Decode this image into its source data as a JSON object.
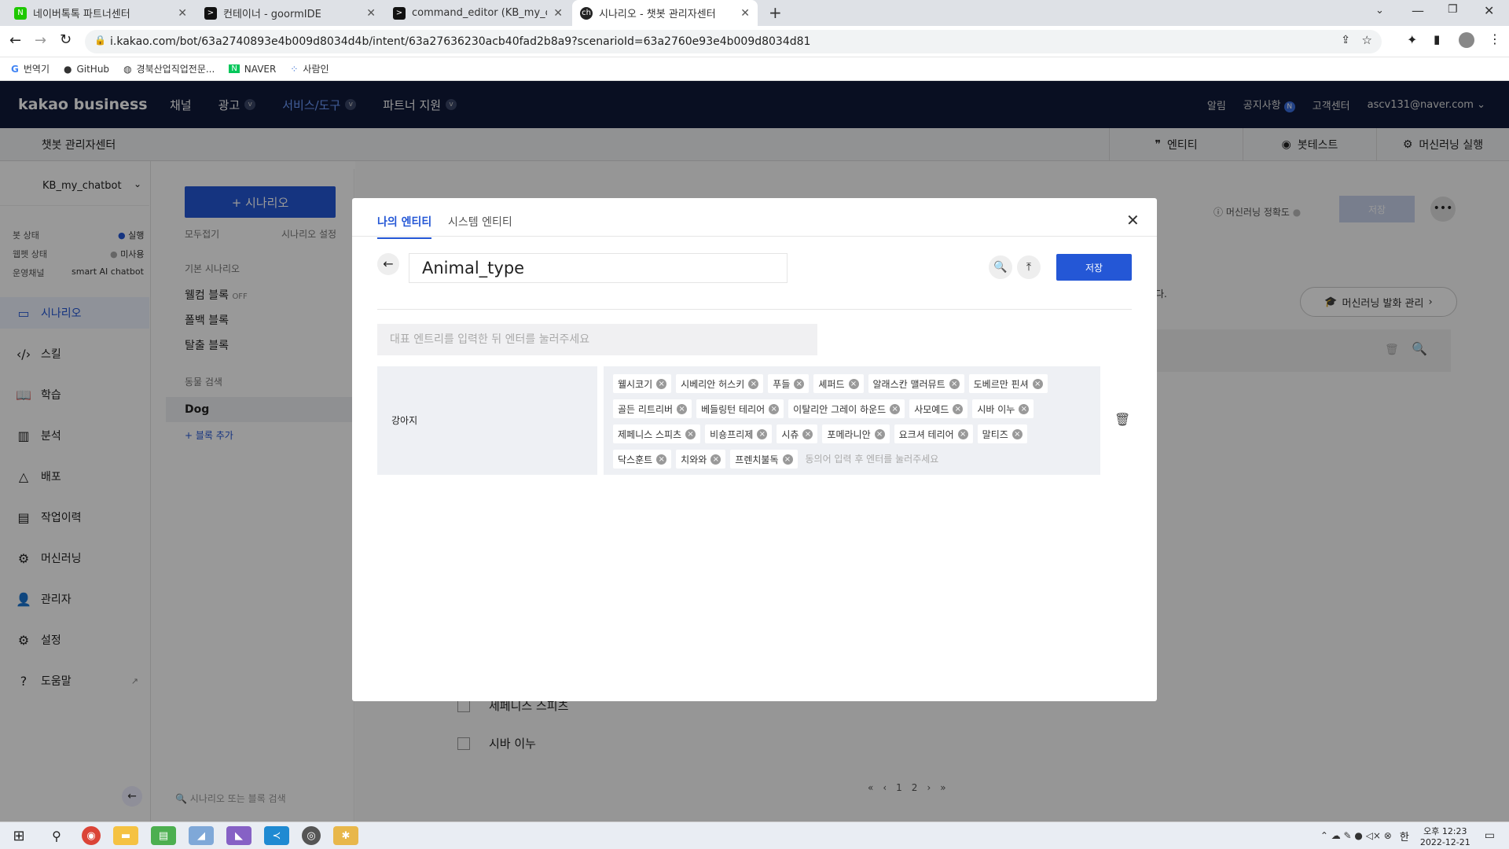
{
  "browser": {
    "tabs": [
      {
        "title": "네이버톡톡 파트너센터",
        "active": false
      },
      {
        "title": "컨테이너 - goormIDE",
        "active": false
      },
      {
        "title": "command_editor (KB_my_chatbc",
        "active": false
      },
      {
        "title": "시나리오 - 챗봇 관리자센터",
        "active": true
      }
    ],
    "url": "i.kakao.com/bot/63a2740893e4b009d8034d4b/intent/63a27636230acb40fad2b8a9?scenarioId=63a2760e93e4b009d8034d81",
    "bookmarks": [
      "번역기",
      "GitHub",
      "경북산업직업전문...",
      "NAVER",
      "사람인"
    ]
  },
  "header": {
    "logo": "kakao business",
    "nav": [
      "채널",
      "광고",
      "서비스/도구",
      "파트너 지원"
    ],
    "right": [
      "알림",
      "공지사항",
      "고객센터",
      "ascv131@naver.com"
    ],
    "notice_badge": "N"
  },
  "subheader": {
    "title": "챗봇 관리자센터",
    "tools": [
      "엔티티",
      "봇테스트",
      "머신러닝 실행"
    ]
  },
  "sidebar": {
    "bot_name": "KB_my_chatbot",
    "status": [
      {
        "label": "봇 상태",
        "value": "실행"
      },
      {
        "label": "웹펫 상태",
        "value": "미사용"
      },
      {
        "label": "운영채널",
        "value": "smart AI chatbot"
      }
    ],
    "items": [
      "시나리오",
      "스킬",
      "학습",
      "분석",
      "배포",
      "작업이력",
      "머신러닝",
      "관리자",
      "설정",
      "도움말"
    ]
  },
  "scenario_panel": {
    "add_button": "+ 시나리오",
    "collapse_all": "모두접기",
    "settings": "시나리오 설정",
    "group1_title": "기본 시나리오",
    "group1_items": [
      "웰컴 블록",
      "폴백 블록",
      "탈출 블록"
    ],
    "off_badge": "OFF",
    "group2_title": "동물 검색",
    "group2_items": [
      "Dog"
    ],
    "add_block": "+ 블록 추가",
    "search_placeholder": "시나리오 또는 블록 검색"
  },
  "background_main": {
    "ml_accuracy": "머신러닝 정확도",
    "save": "저장",
    "ml_manage": "머신러닝 발화 관리",
    "rows": [
      "세페니스 스피츠",
      "시바 이누"
    ],
    "pages": [
      "1",
      "2"
    ],
    "partial_text": "다."
  },
  "modal": {
    "tabs": [
      "나의 엔티티",
      "시스템 엔티티"
    ],
    "entity_name": "Animal_type",
    "save_button": "저장",
    "rep_placeholder": "대표 엔트리를 입력한 뒤 엔터를 눌러주세요",
    "entry": {
      "representative": "강아지",
      "synonyms": [
        "웰시코기",
        "시베리안 허스키",
        "푸들",
        "셰퍼드",
        "알래스칸 맬러뮤트",
        "도베르만 핀셔",
        "골든 리트리버",
        "베들링턴 테리어",
        "이탈리안 그레이 하운드",
        "사모예드",
        "시바 이누",
        "제페니스 스피츠",
        "비숑프리제",
        "시츄",
        "포메라니안",
        "요크셔 테리어",
        "말티즈",
        "닥스훈트",
        "치와와",
        "프렌치불독"
      ],
      "synonym_placeholder": "동의어 입력 후 엔터를 눌러주세요"
    }
  },
  "taskbar": {
    "time": "오후 12:23",
    "date": "2022-12-21",
    "ime": "한"
  }
}
